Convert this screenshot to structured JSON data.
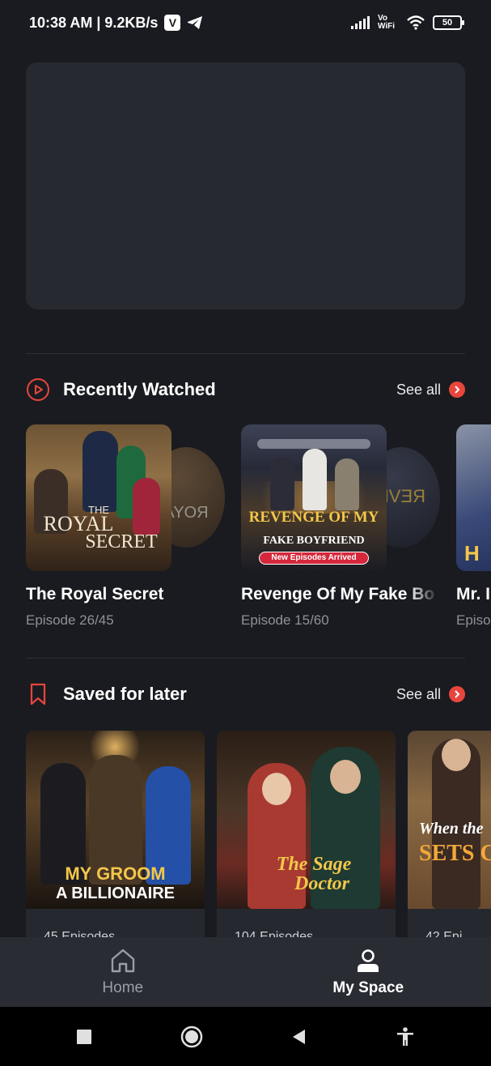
{
  "status_bar": {
    "time_speed": "10:38 AM | 9.2KB/s",
    "v_app": "V",
    "vowifi": "Vo WiFi",
    "battery": "50"
  },
  "recently_watched": {
    "title": "Recently Watched",
    "see_all": "See all",
    "items": [
      {
        "title": "The Royal Secret",
        "episode": "Episode 26/45",
        "poster_text_1": "THE",
        "poster_text_2": "ROYAL",
        "poster_text_3": "SECRET",
        "ghost_text": "ROYA"
      },
      {
        "title": "Revenge Of My Fake Bo",
        "episode": "Episode 15/60",
        "poster_text_1": "REVENGE OF MY",
        "poster_text_2": "FAKE BOYFRIEND",
        "badge": "New Episodes Arrived",
        "ghost_text": "REVE"
      },
      {
        "title": "Mr. I",
        "episode": "Episo",
        "poster_text_1": "H"
      }
    ]
  },
  "saved_for_later": {
    "title": "Saved for later",
    "see_all": "See all",
    "items": [
      {
        "poster_text_1": "MY GROOM",
        "poster_text_2": "A BILLIONAIRE",
        "meta": "45 Episodes"
      },
      {
        "poster_text_1": "The Sage",
        "poster_text_2": "Doctor",
        "meta": "104 Episodes"
      },
      {
        "poster_text_1": "When the",
        "poster_text_2": "SETS C",
        "meta": "42 Epi"
      }
    ]
  },
  "bottom_nav": {
    "home": "Home",
    "my_space": "My Space"
  },
  "colors": {
    "background": "#1a1b20",
    "accent": "#e8453c",
    "card": "#262830",
    "nav": "#2a2c33"
  }
}
